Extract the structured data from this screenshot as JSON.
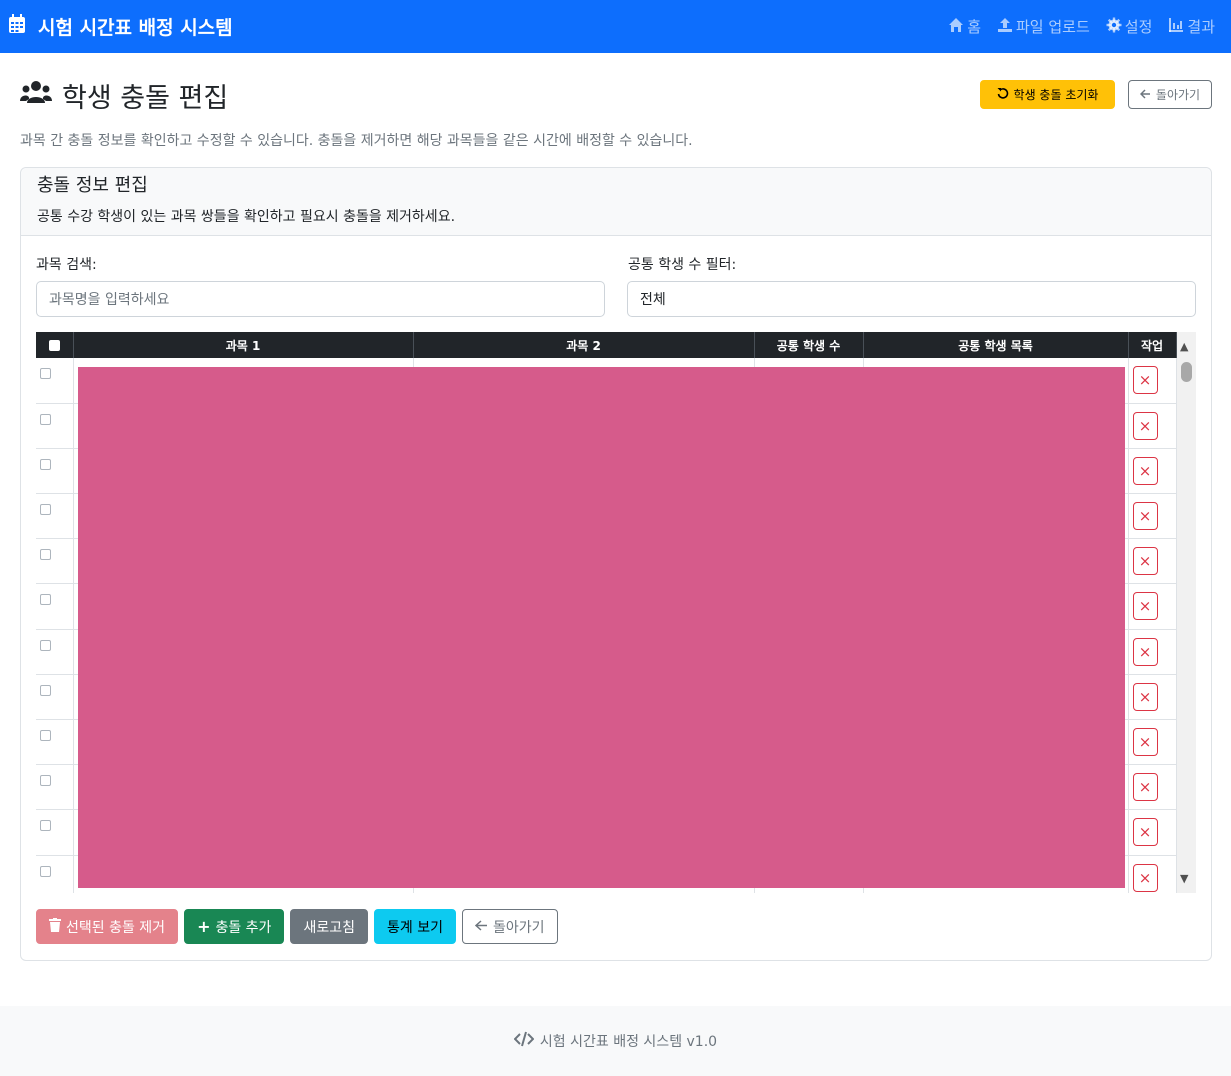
{
  "navbar": {
    "brand": "시험 시간표 배정 시스템",
    "links": [
      {
        "label": "홈",
        "icon": "home-icon"
      },
      {
        "label": "파일 업로드",
        "icon": "upload-icon"
      },
      {
        "label": "설정",
        "icon": "gear-icon"
      },
      {
        "label": "결과",
        "icon": "chart-icon"
      }
    ]
  },
  "page": {
    "title": "학생 충돌 편집",
    "reset_button": "학생 충돌 초기화",
    "back_button": "돌아가기",
    "lead": "과목 간 충돌 정보를 확인하고 수정할 수 있습니다. 충돌을 제거하면 해당 과목들을 같은 시간에 배정할 수 있습니다."
  },
  "card": {
    "title": "충돌 정보 편집",
    "subtitle": "공통 수강 학생이 있는 과목 쌍들을 확인하고 필요시 충돌을 제거하세요.",
    "search": {
      "label": "과목 검색:",
      "placeholder": "과목명을 입력하세요"
    },
    "filter": {
      "label": "공통 학생 수 필터:",
      "value": "전체"
    }
  },
  "table": {
    "columns": [
      "과목 1",
      "과목 2",
      "공통 학생 수",
      "공통 학생 목록",
      "작업"
    ],
    "delete_symbol": "×",
    "row_count": 12
  },
  "actions": {
    "remove_selected": "선택된 충돌 제거",
    "add_conflict": "충돌 추가",
    "refresh": "새로고침",
    "stats": "통계 보기",
    "back": "돌아가기"
  },
  "footer": {
    "text": "시험 시간표 배정 시스템 v1.0"
  },
  "colors": {
    "primary": "#0d6efd",
    "warning": "#ffc107",
    "success": "#198754",
    "danger": "#dc3545",
    "info": "#0dcaf0",
    "redaction": "#d65b8b"
  }
}
